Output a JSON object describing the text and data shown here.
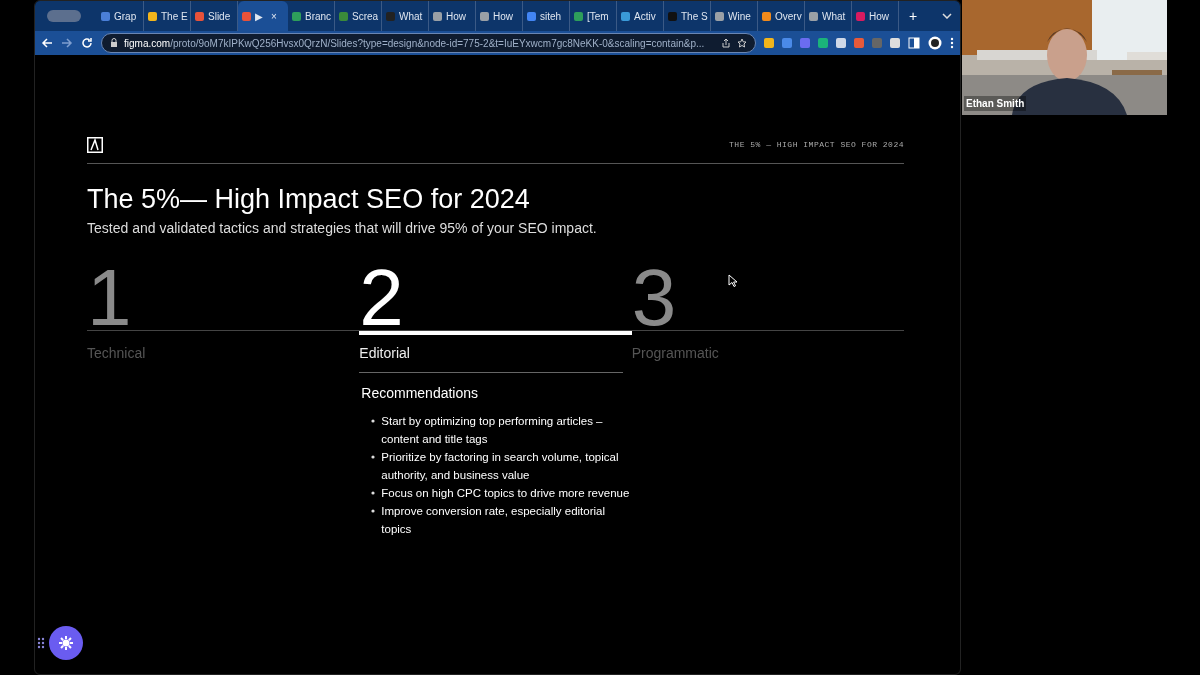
{
  "browser": {
    "tabs": [
      {
        "label": "Grap",
        "color": "#4a7fd8",
        "selected": false
      },
      {
        "label": "The E",
        "color": "#f2b51c",
        "selected": false
      },
      {
        "label": "Slide",
        "color": "#e8523a",
        "selected": false
      },
      {
        "label": "▶",
        "color": "#e8523a",
        "selected": true,
        "close": "×"
      },
      {
        "label": "Branc",
        "color": "#2e9e5b",
        "selected": false
      },
      {
        "label": "Screa",
        "color": "#3a8a3a",
        "selected": false
      },
      {
        "label": "What",
        "color": "#222222",
        "selected": false
      },
      {
        "label": "How",
        "color": "#9aa0a6",
        "selected": false
      },
      {
        "label": "How",
        "color": "#9aa0a6",
        "selected": false
      },
      {
        "label": "siteh",
        "color": "#4285f4",
        "selected": false
      },
      {
        "label": "[Tem",
        "color": "#2e9e5b",
        "selected": false
      },
      {
        "label": "Activ",
        "color": "#3a9ad8",
        "selected": false
      },
      {
        "label": "The S",
        "color": "#111111",
        "selected": false
      },
      {
        "label": "Wine",
        "color": "#9aa0a6",
        "selected": false
      },
      {
        "label": "Overv",
        "color": "#f08a1c",
        "selected": false
      },
      {
        "label": "What",
        "color": "#9aa0a6",
        "selected": false
      },
      {
        "label": "How",
        "color": "#d81b60",
        "selected": false
      }
    ],
    "new_tab": "+",
    "url": {
      "host": "figma.com",
      "path": "/proto/9oM7kIPKwQ256Hvsx0QrzN/Slides?type=design&node-id=775-2&t=IuEYxwcm7gc8NeKK-0&scaling=contain&p..."
    }
  },
  "slide": {
    "header": "THE 5% — HIGH IMPACT SEO FOR 2024",
    "title": "The 5%— High Impact SEO for 2024",
    "subtitle": "Tested and validated tactics and strategies that will drive 95% of your SEO impact.",
    "columns": [
      {
        "number": "1",
        "label": "Technical",
        "selected": false
      },
      {
        "number": "2",
        "label": "Editorial",
        "selected": true,
        "heading": "Recommendations",
        "bullets": [
          "Start by optimizing top performing articles – content and title tags",
          "Prioritize by factoring in search volume, topical authority, and business value",
          "Focus on high CPC topics to drive more revenue",
          "Improve conversion rate, especially editorial topics"
        ]
      },
      {
        "number": "3",
        "label": "Programmatic",
        "selected": false
      }
    ]
  },
  "video": {
    "kind": "picture",
    "name": "Ethan Smith"
  }
}
